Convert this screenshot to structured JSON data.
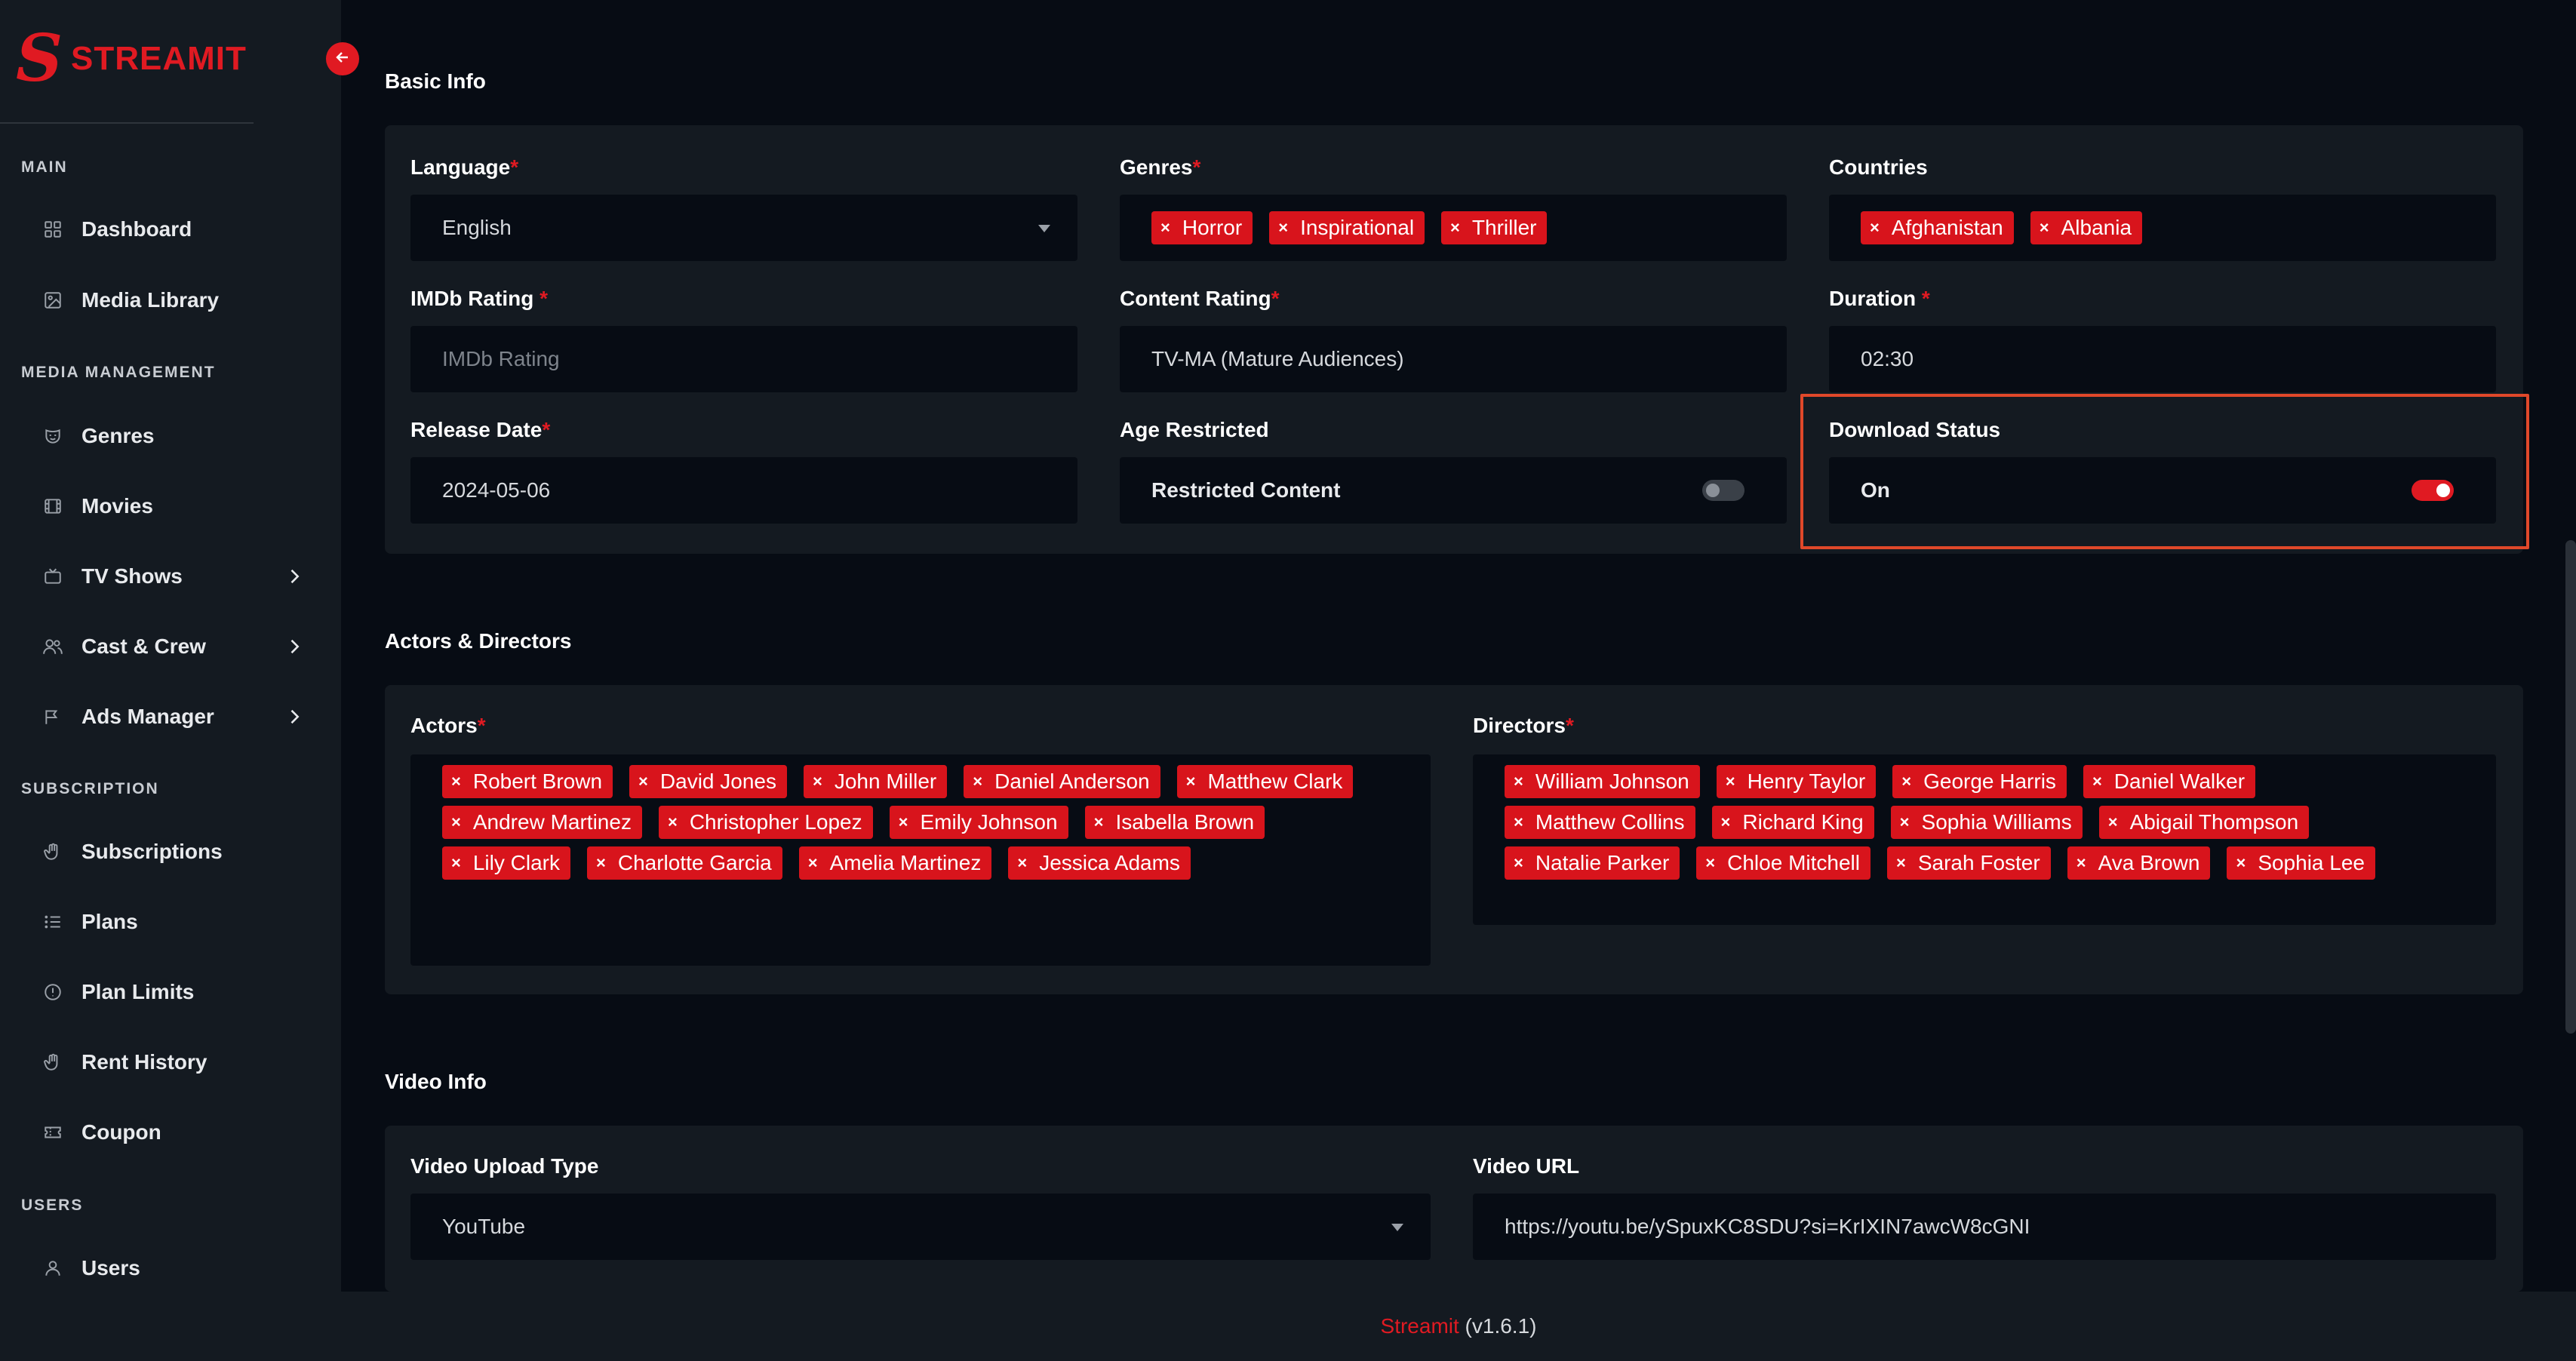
{
  "brand": {
    "name": "STREAMIT",
    "logo_letter": "S",
    "accent": "#e01a22"
  },
  "sidebar": {
    "sections": [
      {
        "title": "MAIN",
        "items": [
          {
            "label": "Dashboard",
            "icon": "dashboard-icon"
          },
          {
            "label": "Media Library",
            "icon": "image-icon"
          }
        ]
      },
      {
        "title": "MEDIA MANAGEMENT",
        "items": [
          {
            "label": "Genres",
            "icon": "mask-icon"
          },
          {
            "label": "Movies",
            "icon": "film-icon"
          },
          {
            "label": "TV Shows",
            "icon": "tv-icon",
            "expandable": true
          },
          {
            "label": "Cast & Crew",
            "icon": "users-icon",
            "expandable": true
          },
          {
            "label": "Ads Manager",
            "icon": "megaphone-icon",
            "expandable": true
          }
        ]
      },
      {
        "title": "SUBSCRIPTION",
        "items": [
          {
            "label": "Subscriptions",
            "icon": "hand-icon"
          },
          {
            "label": "Plans",
            "icon": "list-icon"
          },
          {
            "label": "Plan Limits",
            "icon": "alert-circle-icon"
          },
          {
            "label": "Rent History",
            "icon": "hand-icon"
          },
          {
            "label": "Coupon",
            "icon": "ticket-icon"
          }
        ]
      },
      {
        "title": "USERS",
        "items": [
          {
            "label": "Users",
            "icon": "user-icon"
          }
        ]
      }
    ]
  },
  "basic_info": {
    "title": "Basic Info",
    "language": {
      "label": "Language",
      "value": "English"
    },
    "genres": {
      "label": "Genres",
      "tags": [
        "Horror",
        "Inspirational",
        "Thriller"
      ]
    },
    "countries": {
      "label": "Countries",
      "tags": [
        "Afghanistan",
        "Albania"
      ]
    },
    "imdb": {
      "label": "IMDb Rating",
      "placeholder": "IMDb Rating"
    },
    "content_rating": {
      "label": "Content Rating",
      "value": "TV-MA (Mature Audiences)"
    },
    "duration": {
      "label": "Duration",
      "value": "02:30"
    },
    "release_date": {
      "label": "Release Date",
      "value": "2024-05-06"
    },
    "age_restricted": {
      "label": "Age Restricted",
      "toggle_label": "Restricted Content",
      "on": false
    },
    "download_status": {
      "label": "Download Status",
      "toggle_label": "On",
      "on": true
    }
  },
  "actors_directors": {
    "title": "Actors & Directors",
    "actors": {
      "label": "Actors",
      "tags": [
        "Robert Brown",
        "David Jones",
        "John Miller",
        "Daniel Anderson",
        "Matthew Clark",
        "Andrew Martinez",
        "Christopher Lopez",
        "Emily Johnson",
        "Isabella Brown",
        "Lily Clark",
        "Charlotte Garcia",
        "Amelia Martinez",
        "Jessica Adams"
      ]
    },
    "directors": {
      "label": "Directors",
      "tags": [
        "William Johnson",
        "Henry Taylor",
        "George Harris",
        "Daniel Walker",
        "Matthew Collins",
        "Richard King",
        "Sophia Williams",
        "Abigail Thompson",
        "Natalie Parker",
        "Chloe Mitchell",
        "Sarah Foster",
        "Ava Brown",
        "Sophia Lee"
      ]
    }
  },
  "video_info": {
    "title": "Video Info",
    "upload_type": {
      "label": "Video Upload Type",
      "value": "YouTube"
    },
    "url": {
      "label": "Video URL",
      "value": "https://youtu.be/ySpuxKC8SDU?si=KrIXIN7awcW8cGNI"
    }
  },
  "footer": {
    "brand": "Streamit",
    "version": " (v1.6.1)"
  },
  "required_mark": "*",
  "tag_remove": "×"
}
